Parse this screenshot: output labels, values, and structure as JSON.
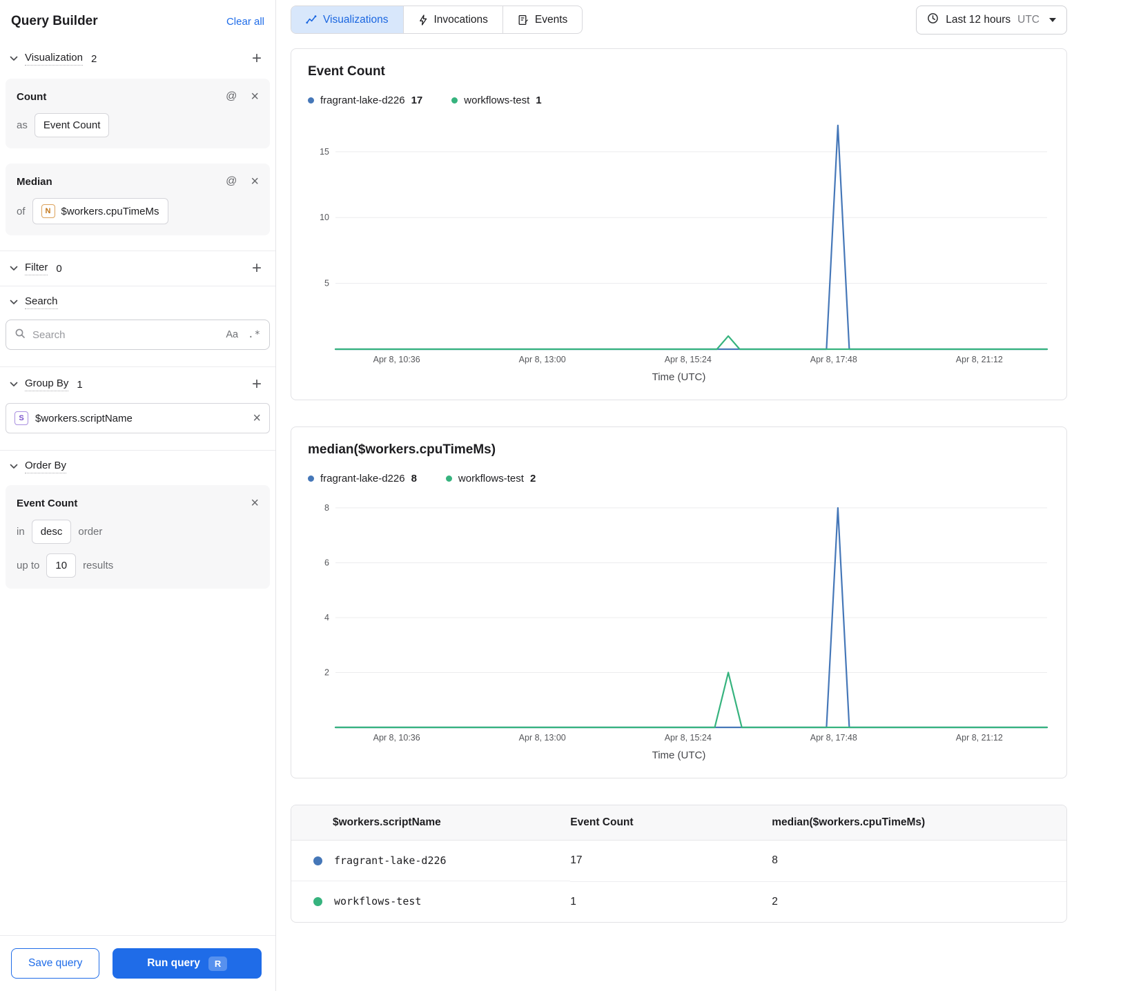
{
  "colors": {
    "accent_blue": "#1f6ce8",
    "series_blue": "#4577b8",
    "series_green": "#36b37e"
  },
  "sidebar": {
    "title": "Query Builder",
    "clear_all_label": "Clear all",
    "visualization": {
      "label": "Visualization",
      "count": "2",
      "cards": [
        {
          "title": "Count",
          "connector": "as",
          "value": "Event Count"
        },
        {
          "title": "Median",
          "connector": "of",
          "badge": "N",
          "value": "$workers.cpuTimeMs"
        }
      ]
    },
    "filter": {
      "label": "Filter",
      "count": "0"
    },
    "search": {
      "label": "Search",
      "placeholder": "Search",
      "match_case_label": "Aa",
      "regex_label": ".*"
    },
    "group_by": {
      "label": "Group By",
      "count": "1",
      "item": {
        "badge": "S",
        "value": "$workers.scriptName"
      }
    },
    "order_by": {
      "label": "Order By",
      "field": "Event Count",
      "in_label": "in",
      "direction": "desc",
      "order_label": "order",
      "up_to_label": "up to",
      "limit": "10",
      "results_label": "results"
    },
    "save_button": "Save query",
    "run_button": "Run query",
    "run_shortcut": "R"
  },
  "header": {
    "tabs": [
      {
        "label": "Visualizations"
      },
      {
        "label": "Invocations"
      },
      {
        "label": "Events"
      }
    ],
    "time_range": {
      "label": "Last 12 hours",
      "zone": "UTC"
    }
  },
  "chart_data": [
    {
      "type": "line",
      "title": "Event Count",
      "xlabel": "Time (UTC)",
      "x_ticks": [
        "Apr 8, 10:36",
        "Apr 8, 13:00",
        "Apr 8, 15:24",
        "Apr 8, 17:48",
        "Apr 8, 21:12"
      ],
      "y_ticks": [
        5,
        10,
        15
      ],
      "ylim": [
        0,
        17.3
      ],
      "grid": true,
      "legend_position": "top",
      "series": [
        {
          "name": "fragrant-lake-d226",
          "legend_value": "17",
          "color": "#4577b8",
          "points": [
            [
              0,
              0
            ],
            [
              0.69,
              0
            ],
            [
              0.706,
              17
            ],
            [
              0.722,
              0
            ],
            [
              1,
              0
            ]
          ]
        },
        {
          "name": "workflows-test",
          "legend_value": "1",
          "color": "#36b37e",
          "points": [
            [
              0,
              0
            ],
            [
              0.536,
              0
            ],
            [
              0.552,
              1
            ],
            [
              0.568,
              0
            ],
            [
              1,
              0
            ]
          ]
        }
      ]
    },
    {
      "type": "line",
      "title": "median($workers.cpuTimeMs)",
      "xlabel": "Time (UTC)",
      "x_ticks": [
        "Apr 8, 10:36",
        "Apr 8, 13:00",
        "Apr 8, 15:24",
        "Apr 8, 17:48",
        "Apr 8, 21:12"
      ],
      "y_ticks": [
        2,
        4,
        6,
        8
      ],
      "ylim": [
        0,
        8.3
      ],
      "grid": true,
      "legend_position": "top",
      "series": [
        {
          "name": "fragrant-lake-d226",
          "legend_value": "8",
          "color": "#4577b8",
          "points": [
            [
              0,
              0
            ],
            [
              0.69,
              0
            ],
            [
              0.706,
              8
            ],
            [
              0.722,
              0
            ],
            [
              1,
              0
            ]
          ]
        },
        {
          "name": "workflows-test",
          "legend_value": "2",
          "color": "#36b37e",
          "points": [
            [
              0,
              0
            ],
            [
              0.533,
              0
            ],
            [
              0.552,
              2
            ],
            [
              0.571,
              0
            ],
            [
              1,
              0
            ]
          ]
        }
      ]
    }
  ],
  "table": {
    "columns": [
      "$workers.scriptName",
      "Event Count",
      "median($workers.cpuTimeMs)"
    ],
    "rows": [
      {
        "color": "#4577b8",
        "name": "fragrant-lake-d226",
        "event_count": "17",
        "median": "8"
      },
      {
        "color": "#36b37e",
        "name": "workflows-test",
        "event_count": "1",
        "median": "2"
      }
    ]
  }
}
